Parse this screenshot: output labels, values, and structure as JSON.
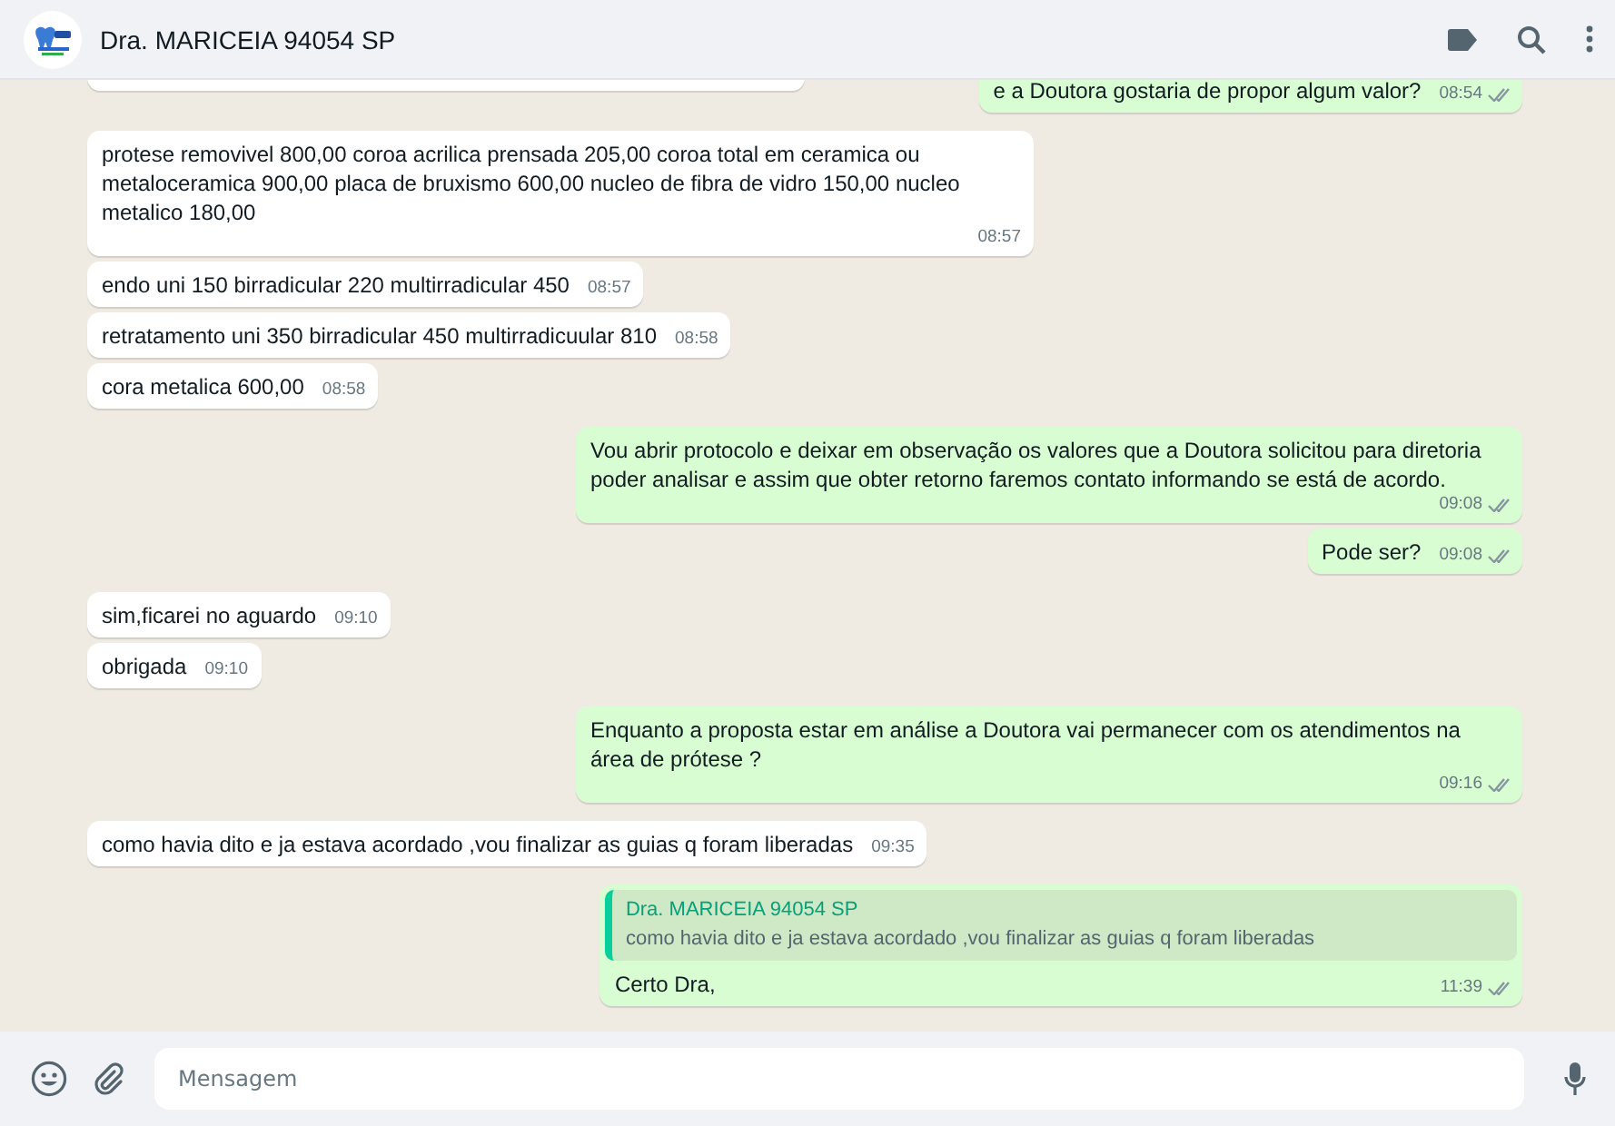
{
  "header": {
    "title": "Dra. MARICEIA 94054 SP"
  },
  "messages": [
    {
      "outgoing": true,
      "text": "e a Doutora gostaria de propor algum valor?",
      "time": "08:54",
      "read": false
    },
    {
      "outgoing": false,
      "text": "protese removivel 800,00 coroa acrilica prensada 205,00 coroa total em ceramica ou metaloceramica 900,00 placa de bruxismo 600,00 nucleo de fibra de vidro 150,00 nucleo metalico 180,00",
      "time": "08:57"
    },
    {
      "outgoing": false,
      "text": "endo uni 150 birradicular 220 multirradicular 450",
      "time": "08:57"
    },
    {
      "outgoing": false,
      "text": "retratamento uni 350 birradicular 450 multirradicuular 810",
      "time": "08:58"
    },
    {
      "outgoing": false,
      "text": "cora metalica 600,00",
      "time": "08:58"
    },
    {
      "outgoing": true,
      "text": "Vou abrir protocolo e deixar em observação os valores que a Doutora solicitou para diretoria poder analisar e assim que obter retorno faremos contato informando se está de acordo.",
      "time": "09:08",
      "read": false
    },
    {
      "outgoing": true,
      "text": "Pode ser?",
      "time": "09:08",
      "read": false
    },
    {
      "outgoing": false,
      "text": "sim,ficarei no aguardo",
      "time": "09:10"
    },
    {
      "outgoing": false,
      "text": "obrigada",
      "time": "09:10"
    },
    {
      "outgoing": true,
      "text": "Enquanto a proposta estar em análise a Doutora vai permanecer com os atendimentos na área de prótese ?",
      "time": "09:16",
      "read": false
    },
    {
      "outgoing": false,
      "text": "como havia dito e ja estava acordado ,vou finalizar as guias q foram liberadas",
      "time": "09:35"
    },
    {
      "outgoing": true,
      "text": "Certo Dra,",
      "time": "11:39",
      "read": false,
      "quote": {
        "author": "Dra. MARICEIA 94054 SP",
        "text": "como havia dito e ja estava acordado ,vou finalizar as guias q foram liberadas"
      }
    }
  ],
  "composer": {
    "placeholder": "Mensagem"
  }
}
